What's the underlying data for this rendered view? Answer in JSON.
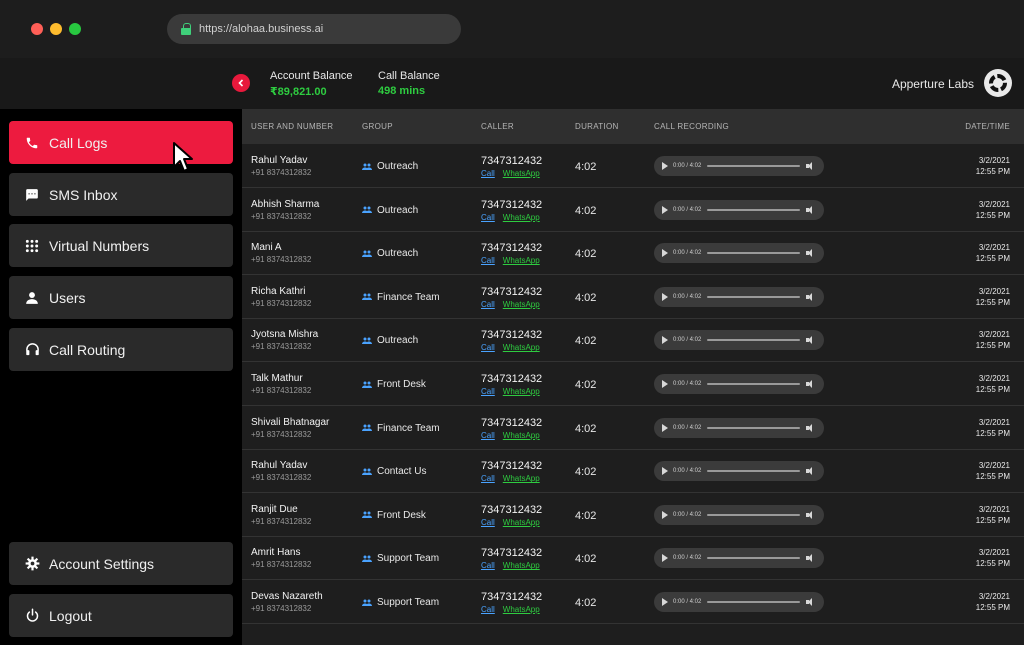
{
  "browser": {
    "url": "https://alohaa.business.ai"
  },
  "header": {
    "account_balance_label": "Account Balance",
    "account_balance_value": "₹89,821.00",
    "call_balance_label": "Call Balance",
    "call_balance_value": "498 mins",
    "company_name": "Apperture Labs"
  },
  "sidebar": {
    "items": [
      {
        "label": "Call Logs",
        "icon": "phone-icon",
        "active": true
      },
      {
        "label": "SMS Inbox",
        "icon": "message-icon"
      },
      {
        "label": "Virtual Numbers",
        "icon": "grid-icon"
      },
      {
        "label": "Users",
        "icon": "user-icon"
      },
      {
        "label": "Call Routing",
        "icon": "headset-icon"
      }
    ],
    "bottom": [
      {
        "label": "Account Settings",
        "icon": "gear-icon"
      },
      {
        "label": "Logout",
        "icon": "power-icon"
      }
    ]
  },
  "table": {
    "headers": [
      "USER AND NUMBER",
      "GROUP",
      "CALLER",
      "DURATION",
      "CALL RECORDING",
      "DATE/TIME"
    ],
    "link_call": "Call",
    "link_whatsapp": "WhatsApp",
    "rows": [
      {
        "name": "Rahul Yadav",
        "number": "+91 8374312832",
        "group": "Outreach",
        "caller": "7347312432",
        "duration": "4:02",
        "rec_time": "0:00 / 4:02",
        "date": "3/2/2021",
        "time": "12:55 PM"
      },
      {
        "name": "Abhish Sharma",
        "number": "+91 8374312832",
        "group": "Outreach",
        "caller": "7347312432",
        "duration": "4:02",
        "rec_time": "0:00 / 4:02",
        "date": "3/2/2021",
        "time": "12:55 PM"
      },
      {
        "name": "Mani A",
        "number": "+91 8374312832",
        "group": "Outreach",
        "caller": "7347312432",
        "duration": "4:02",
        "rec_time": "0:00 / 4:02",
        "date": "3/2/2021",
        "time": "12:55 PM"
      },
      {
        "name": "Richa Kathri",
        "number": "+91 8374312832",
        "group": "Finance Team",
        "caller": "7347312432",
        "duration": "4:02",
        "rec_time": "0:00 / 4:02",
        "date": "3/2/2021",
        "time": "12:55 PM"
      },
      {
        "name": "Jyotsna Mishra",
        "number": "+91 8374312832",
        "group": "Outreach",
        "caller": "7347312432",
        "duration": "4:02",
        "rec_time": "0:00 / 4:02",
        "date": "3/2/2021",
        "time": "12:55 PM"
      },
      {
        "name": "Talk Mathur",
        "number": "+91 8374312832",
        "group": "Front Desk",
        "caller": "7347312432",
        "duration": "4:02",
        "rec_time": "0:00 / 4:02",
        "date": "3/2/2021",
        "time": "12:55 PM"
      },
      {
        "name": "Shivali Bhatnagar",
        "number": "+91 8374312832",
        "group": "Finance Team",
        "caller": "7347312432",
        "duration": "4:02",
        "rec_time": "0:00 / 4:02",
        "date": "3/2/2021",
        "time": "12:55 PM"
      },
      {
        "name": "Rahul Yadav",
        "number": "+91 8374312832",
        "group": "Contact Us",
        "caller": "7347312432",
        "duration": "4:02",
        "rec_time": "0:00 / 4:02",
        "date": "3/2/2021",
        "time": "12:55 PM"
      },
      {
        "name": "Ranjit Due",
        "number": "+91 8374312832",
        "group": "Front Desk",
        "caller": "7347312432",
        "duration": "4:02",
        "rec_time": "0:00 / 4:02",
        "date": "3/2/2021",
        "time": "12:55 PM"
      },
      {
        "name": "Amrit Hans",
        "number": "+91 8374312832",
        "group": "Support Team",
        "caller": "7347312432",
        "duration": "4:02",
        "rec_time": "0:00 / 4:02",
        "date": "3/2/2021",
        "time": "12:55 PM"
      },
      {
        "name": "Devas Nazareth",
        "number": "+91 8374312832",
        "group": "Support Team",
        "caller": "7347312432",
        "duration": "4:02",
        "rec_time": "0:00 / 4:02",
        "date": "3/2/2021",
        "time": "12:55 PM"
      }
    ]
  },
  "colors": {
    "accent": "#ED1B3F",
    "balance": "#2ECC40",
    "link_call": "#4AA3FF",
    "link_whatsapp": "#2ECC40"
  }
}
